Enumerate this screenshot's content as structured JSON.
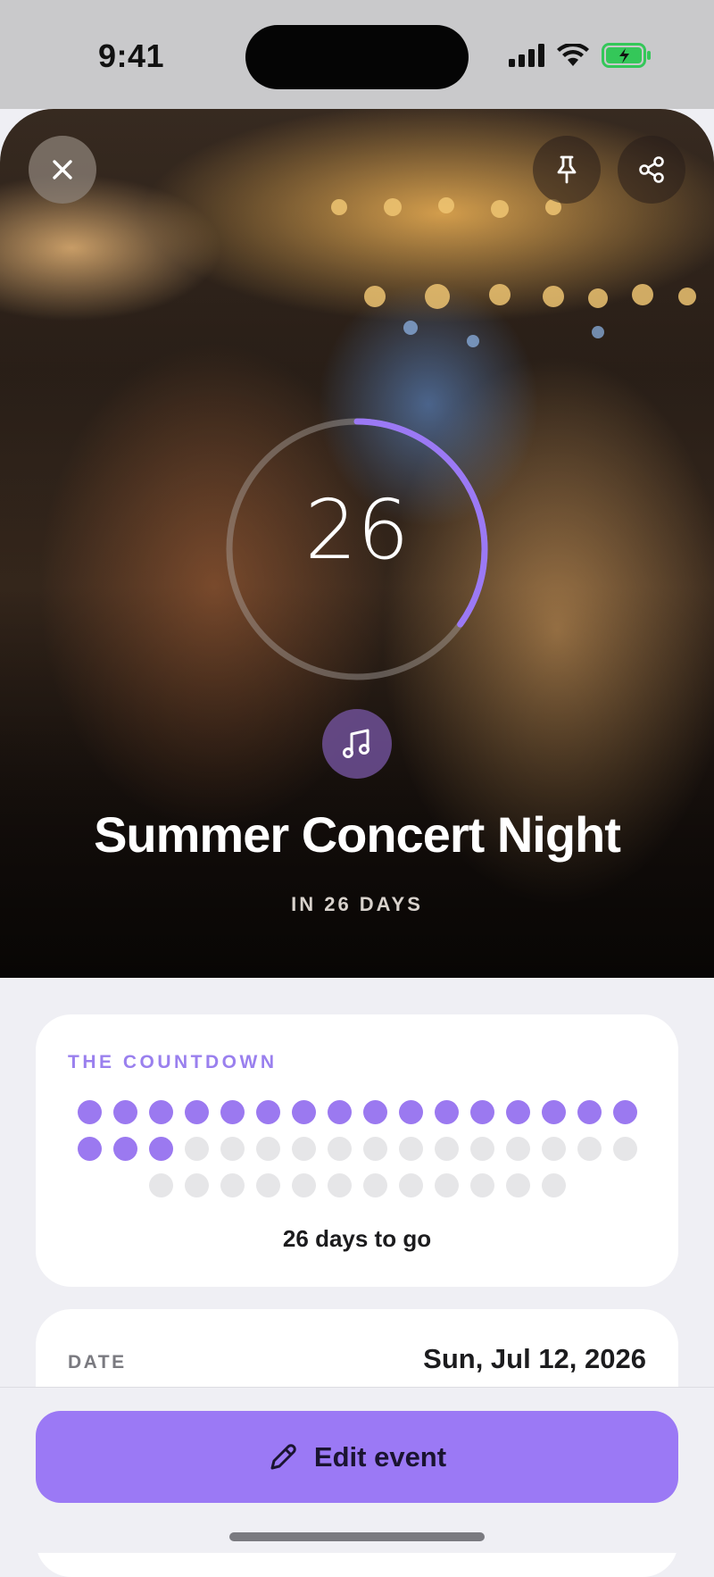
{
  "status_bar": {
    "time": "9:41",
    "battery_color": "#34c759"
  },
  "hero": {
    "countdown_number": "26",
    "progress_fraction": 0.35,
    "accent": "#9b79f5",
    "category_icon": "music-note-icon",
    "title": "Summer Concert Night",
    "subtitle": "IN 26 DAYS",
    "buttons": {
      "close": "close-icon",
      "pin": "pin-icon",
      "share": "share-icon"
    }
  },
  "countdown": {
    "label": "THE COUNTDOWN",
    "total_days": 44,
    "elapsed_days": 19,
    "summary": "26 days to go"
  },
  "details": {
    "date_label": "DATE",
    "date_value": "Sun, Jul 12, 2026"
  },
  "footer": {
    "edit_label": "Edit event",
    "edit_icon": "pencil-icon"
  }
}
